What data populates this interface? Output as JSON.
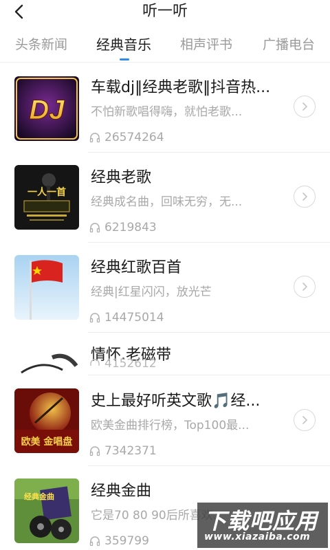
{
  "header": {
    "title": "听一听"
  },
  "tabs": [
    {
      "label": "头条新闻",
      "active": false
    },
    {
      "label": "经典音乐",
      "active": true
    },
    {
      "label": "相声评书",
      "active": false
    },
    {
      "label": "广播电台",
      "active": false
    }
  ],
  "items": [
    {
      "title": "车载dj‖经典老歌‖抖音热...",
      "subtitle": "不怕新歌唱得嗨，就怕老歌...",
      "count": "26574264",
      "cover_text": "DJ"
    },
    {
      "title": "经典老歌",
      "subtitle": "经典成名曲，回味无穷，无...",
      "count": "6219843",
      "cover_text": "一人一首"
    },
    {
      "title": "经典红歌百首",
      "subtitle": "经典|红星闪闪，放光芒",
      "count": "14475014",
      "cover_text": ""
    },
    {
      "title": "情怀.老磁带",
      "subtitle": "",
      "count": "4152612",
      "cover_text": ""
    },
    {
      "title": "史上最好听英文歌🎵经...",
      "subtitle": "欧美金曲排行榜，Top100最...",
      "count": "7342371",
      "cover_text": "欧美 金唱盘"
    },
    {
      "title": "经典金曲",
      "subtitle": "它是70 80 90后所喜欢...",
      "count": "359799",
      "cover_text": "经典金曲"
    }
  ],
  "watermark": {
    "main": "下载吧应用",
    "sub": "www.xiazaiba.com"
  },
  "colors": {
    "accent": "#2e8ce6",
    "title": "#1a1a1a",
    "muted": "#a8a8a8"
  }
}
